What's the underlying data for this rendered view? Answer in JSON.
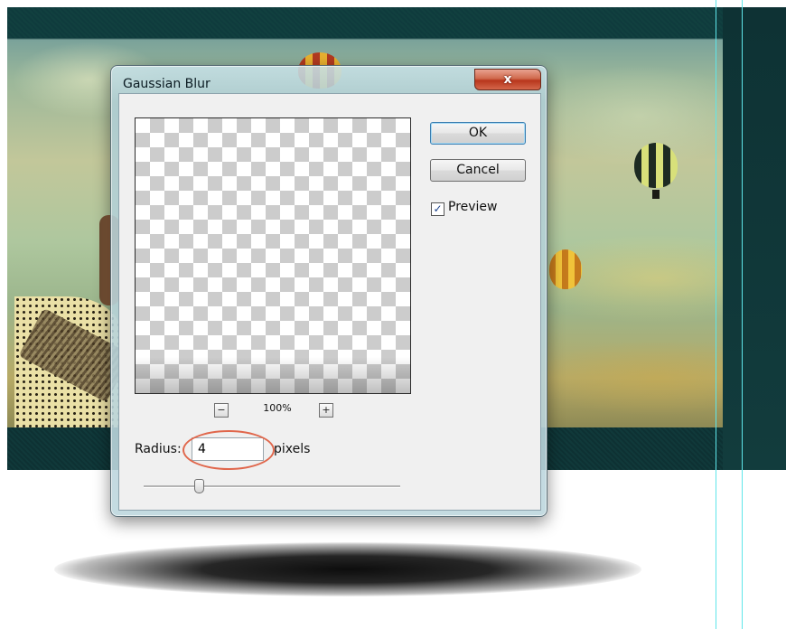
{
  "dialog": {
    "title": "Gaussian Blur",
    "close_label": "x",
    "ok_label": "OK",
    "cancel_label": "Cancel",
    "preview_label": "Preview",
    "preview_checked": true,
    "preview_check_glyph": "✓",
    "zoom": {
      "level": "100%",
      "zoom_out_label": "−",
      "zoom_in_label": "+"
    },
    "radius": {
      "label": "Radius:",
      "value": "4",
      "units": "pixels"
    }
  },
  "colors": {
    "accent_highlight": "#e0674c",
    "guide_line": "#5fe6ea",
    "close_button": "#c44a2e"
  }
}
